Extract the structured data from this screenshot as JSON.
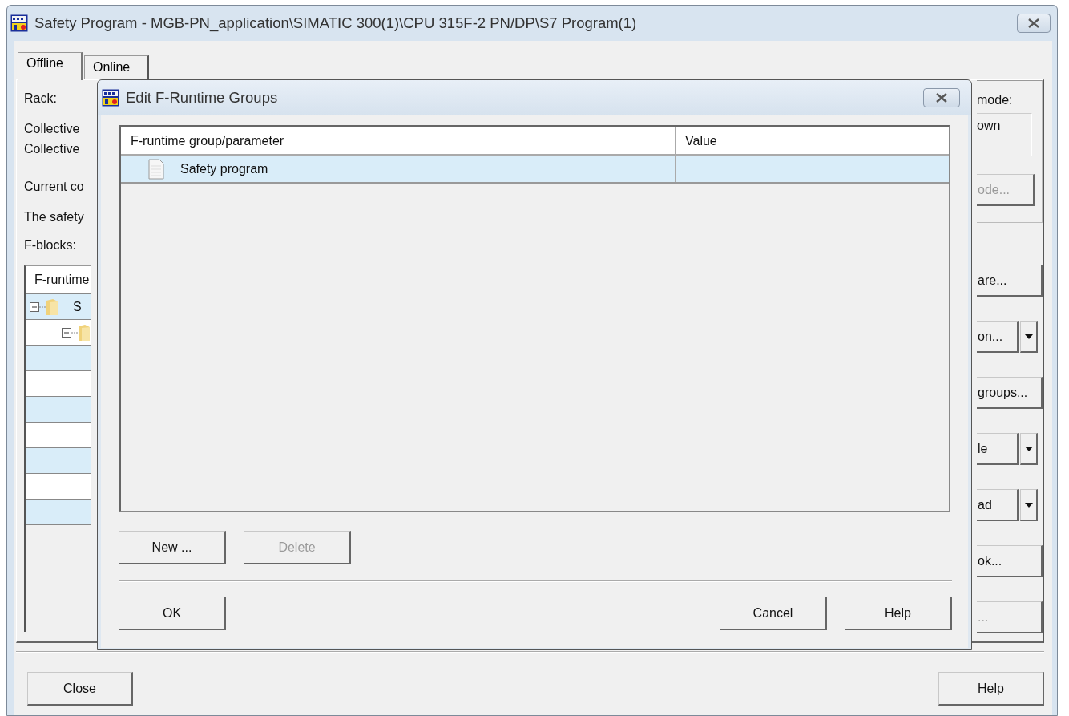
{
  "window": {
    "title": "Safety Program - MGB-PN_application\\SIMATIC 300(1)\\CPU 315F-2 PN/DP\\S7 Program(1)"
  },
  "tabs": [
    {
      "label": "Offline",
      "selected": true
    },
    {
      "label": "Online",
      "selected": false
    }
  ],
  "left_labels": [
    "Rack:",
    "Collective",
    "Collective",
    "Current co",
    "The safety",
    "F-blocks:"
  ],
  "f_blocks_table": {
    "columns": [
      "F-runtime"
    ],
    "rows": [
      {
        "label": "S",
        "expanded": true,
        "children": [
          {
            "expanded": true
          }
        ]
      }
    ]
  },
  "mode_group": {
    "label": "mode:",
    "field_value": "own",
    "button": {
      "label": "ode...",
      "disabled": true
    }
  },
  "side_buttons": [
    {
      "label": "are...",
      "dropdown": false,
      "disabled": false
    },
    {
      "label": "on...",
      "dropdown": true,
      "disabled": false
    },
    {
      "label": "groups...",
      "dropdown": false,
      "disabled": false
    },
    {
      "label": "le",
      "dropdown": true,
      "disabled": false
    },
    {
      "label": "ad",
      "dropdown": true,
      "disabled": false
    },
    {
      "label": "ok...",
      "dropdown": false,
      "disabled": false
    },
    {
      "label": "...",
      "dropdown": false,
      "disabled": true
    }
  ],
  "bottom_buttons": [
    "Close",
    "Help"
  ],
  "dialog": {
    "title": "Edit F-Runtime Groups",
    "table": {
      "columns": [
        "F-runtime group/parameter",
        "Value"
      ],
      "rows": [
        {
          "name": "Safety program",
          "selected": true
        }
      ]
    },
    "buttons": [
      {
        "label": "New ...",
        "disabled": false
      },
      {
        "label": "Delete",
        "disabled": true
      }
    ],
    "footer_buttons": [
      "OK",
      "Cancel",
      "Help"
    ]
  }
}
